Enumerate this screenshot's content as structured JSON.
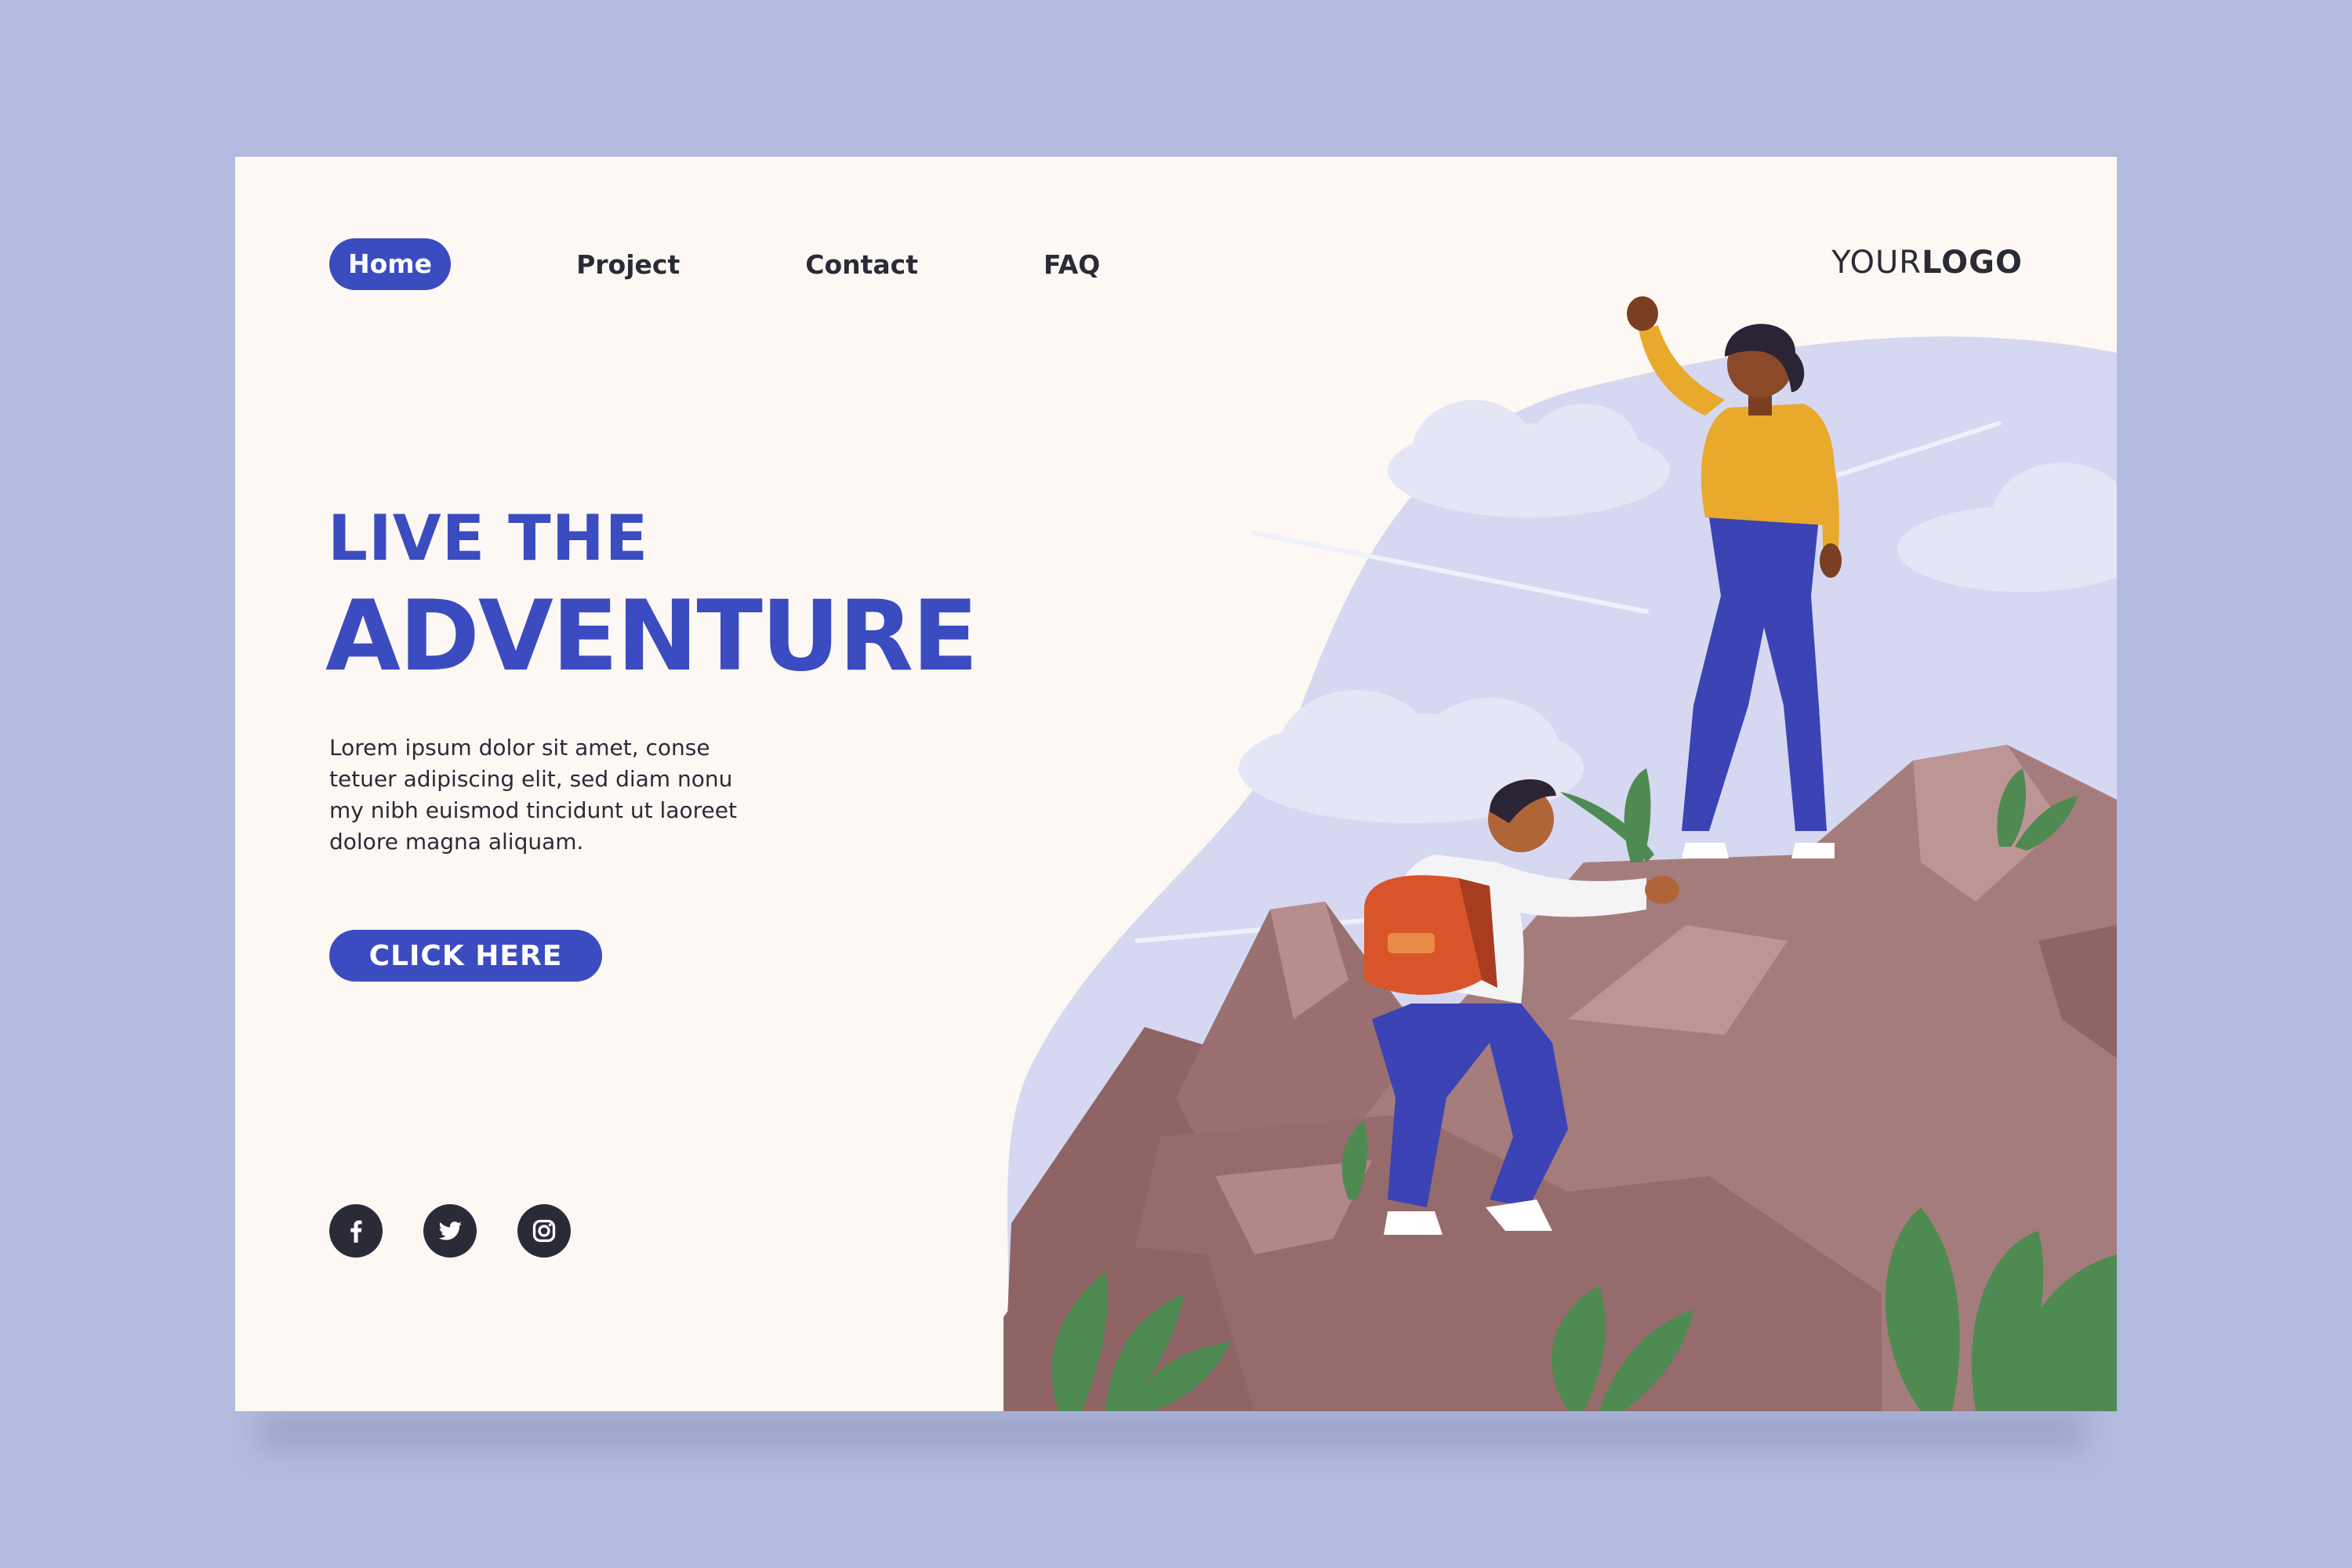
{
  "nav": {
    "items": [
      "Home",
      "Project",
      "Contact",
      "FAQ"
    ],
    "active": "Home"
  },
  "logo": {
    "light": "YOUR",
    "bold": "LOGO"
  },
  "hero": {
    "headline_line1": "LIVE THE",
    "headline_line2": "ADVENTURE",
    "body": "Lorem ipsum dolor sit amet, conse tetuer adipiscing elit, sed diam nonu my nibh euismod tincidunt ut laoreet dolore magna aliquam.",
    "cta_label": "CLICK HERE"
  },
  "social": [
    "facebook-icon",
    "twitter-icon",
    "instagram-icon"
  ],
  "colors": {
    "background": "#b3bbe0",
    "page": "#fdf8f3",
    "accent": "#3b4cc0",
    "text": "#2b2b38",
    "sky": "#d5d8f0",
    "rock": "#a57c7c",
    "rock_dark": "#7f5b5b",
    "leaf": "#4f8a52",
    "shirt_yellow": "#e9a92c",
    "backpack": "#d9542b"
  }
}
